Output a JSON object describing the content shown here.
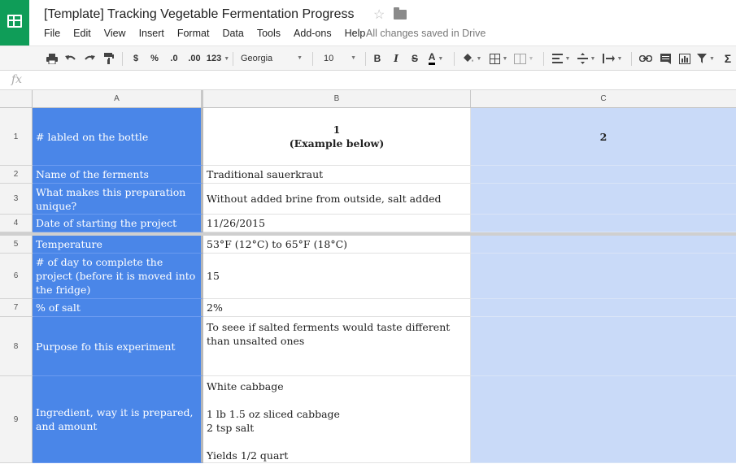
{
  "app": {
    "title": "[Template] Tracking Vegetable Fermentation Progress",
    "save_status": "All changes saved in Drive",
    "menu": [
      "File",
      "Edit",
      "View",
      "Insert",
      "Format",
      "Data",
      "Tools",
      "Add-ons",
      "Help"
    ]
  },
  "toolbar": {
    "currency": "$",
    "percent": "%",
    "decrease_decimals": ".0",
    "increase_decimals": ".00",
    "more_formats": "123",
    "font": "Georgia",
    "font_size": "10",
    "bold": "B",
    "italic": "I",
    "strike": "S",
    "text_color": "A"
  },
  "formula_bar": {
    "fx": "fx",
    "value": ""
  },
  "columns": [
    "A",
    "B",
    "C"
  ],
  "rows": [
    {
      "num": "1",
      "a": "# labled on the bottle",
      "b": "1\n(Example below)",
      "c": "2"
    },
    {
      "num": "2",
      "a": "Name of the ferments",
      "b": "Traditional sauerkraut",
      "c": ""
    },
    {
      "num": "3",
      "a": "What makes this preparation unique?",
      "b": "Without added brine from outside, salt added",
      "c": ""
    },
    {
      "num": "4",
      "a": "Date of starting the project",
      "b": "11/26/2015",
      "c": ""
    },
    {
      "num": "5",
      "a": "Temperature",
      "b": "53°F (12°C) to 65°F (18°C)",
      "c": ""
    },
    {
      "num": "6",
      "a": "# of day to complete the project (before it is moved into the fridge)",
      "b": "15",
      "c": ""
    },
    {
      "num": "7",
      "a": "% of salt",
      "b": "2%",
      "c": ""
    },
    {
      "num": "8",
      "a": "Purpose fo this experiment",
      "b": "To seee if salted ferments would taste different than unsalted ones",
      "c": ""
    },
    {
      "num": "9",
      "a": "Ingredient, way it is prepared, and amount",
      "b": "White cabbage\n\n1 lb 1.5 oz sliced cabbage\n2 tsp salt\n\nYields 1/2 quart",
      "c": ""
    }
  ],
  "colors": {
    "col_a_fill": "#4a86e8",
    "col_c_fill": "#c9daf8",
    "logo": "#0f9d58"
  }
}
